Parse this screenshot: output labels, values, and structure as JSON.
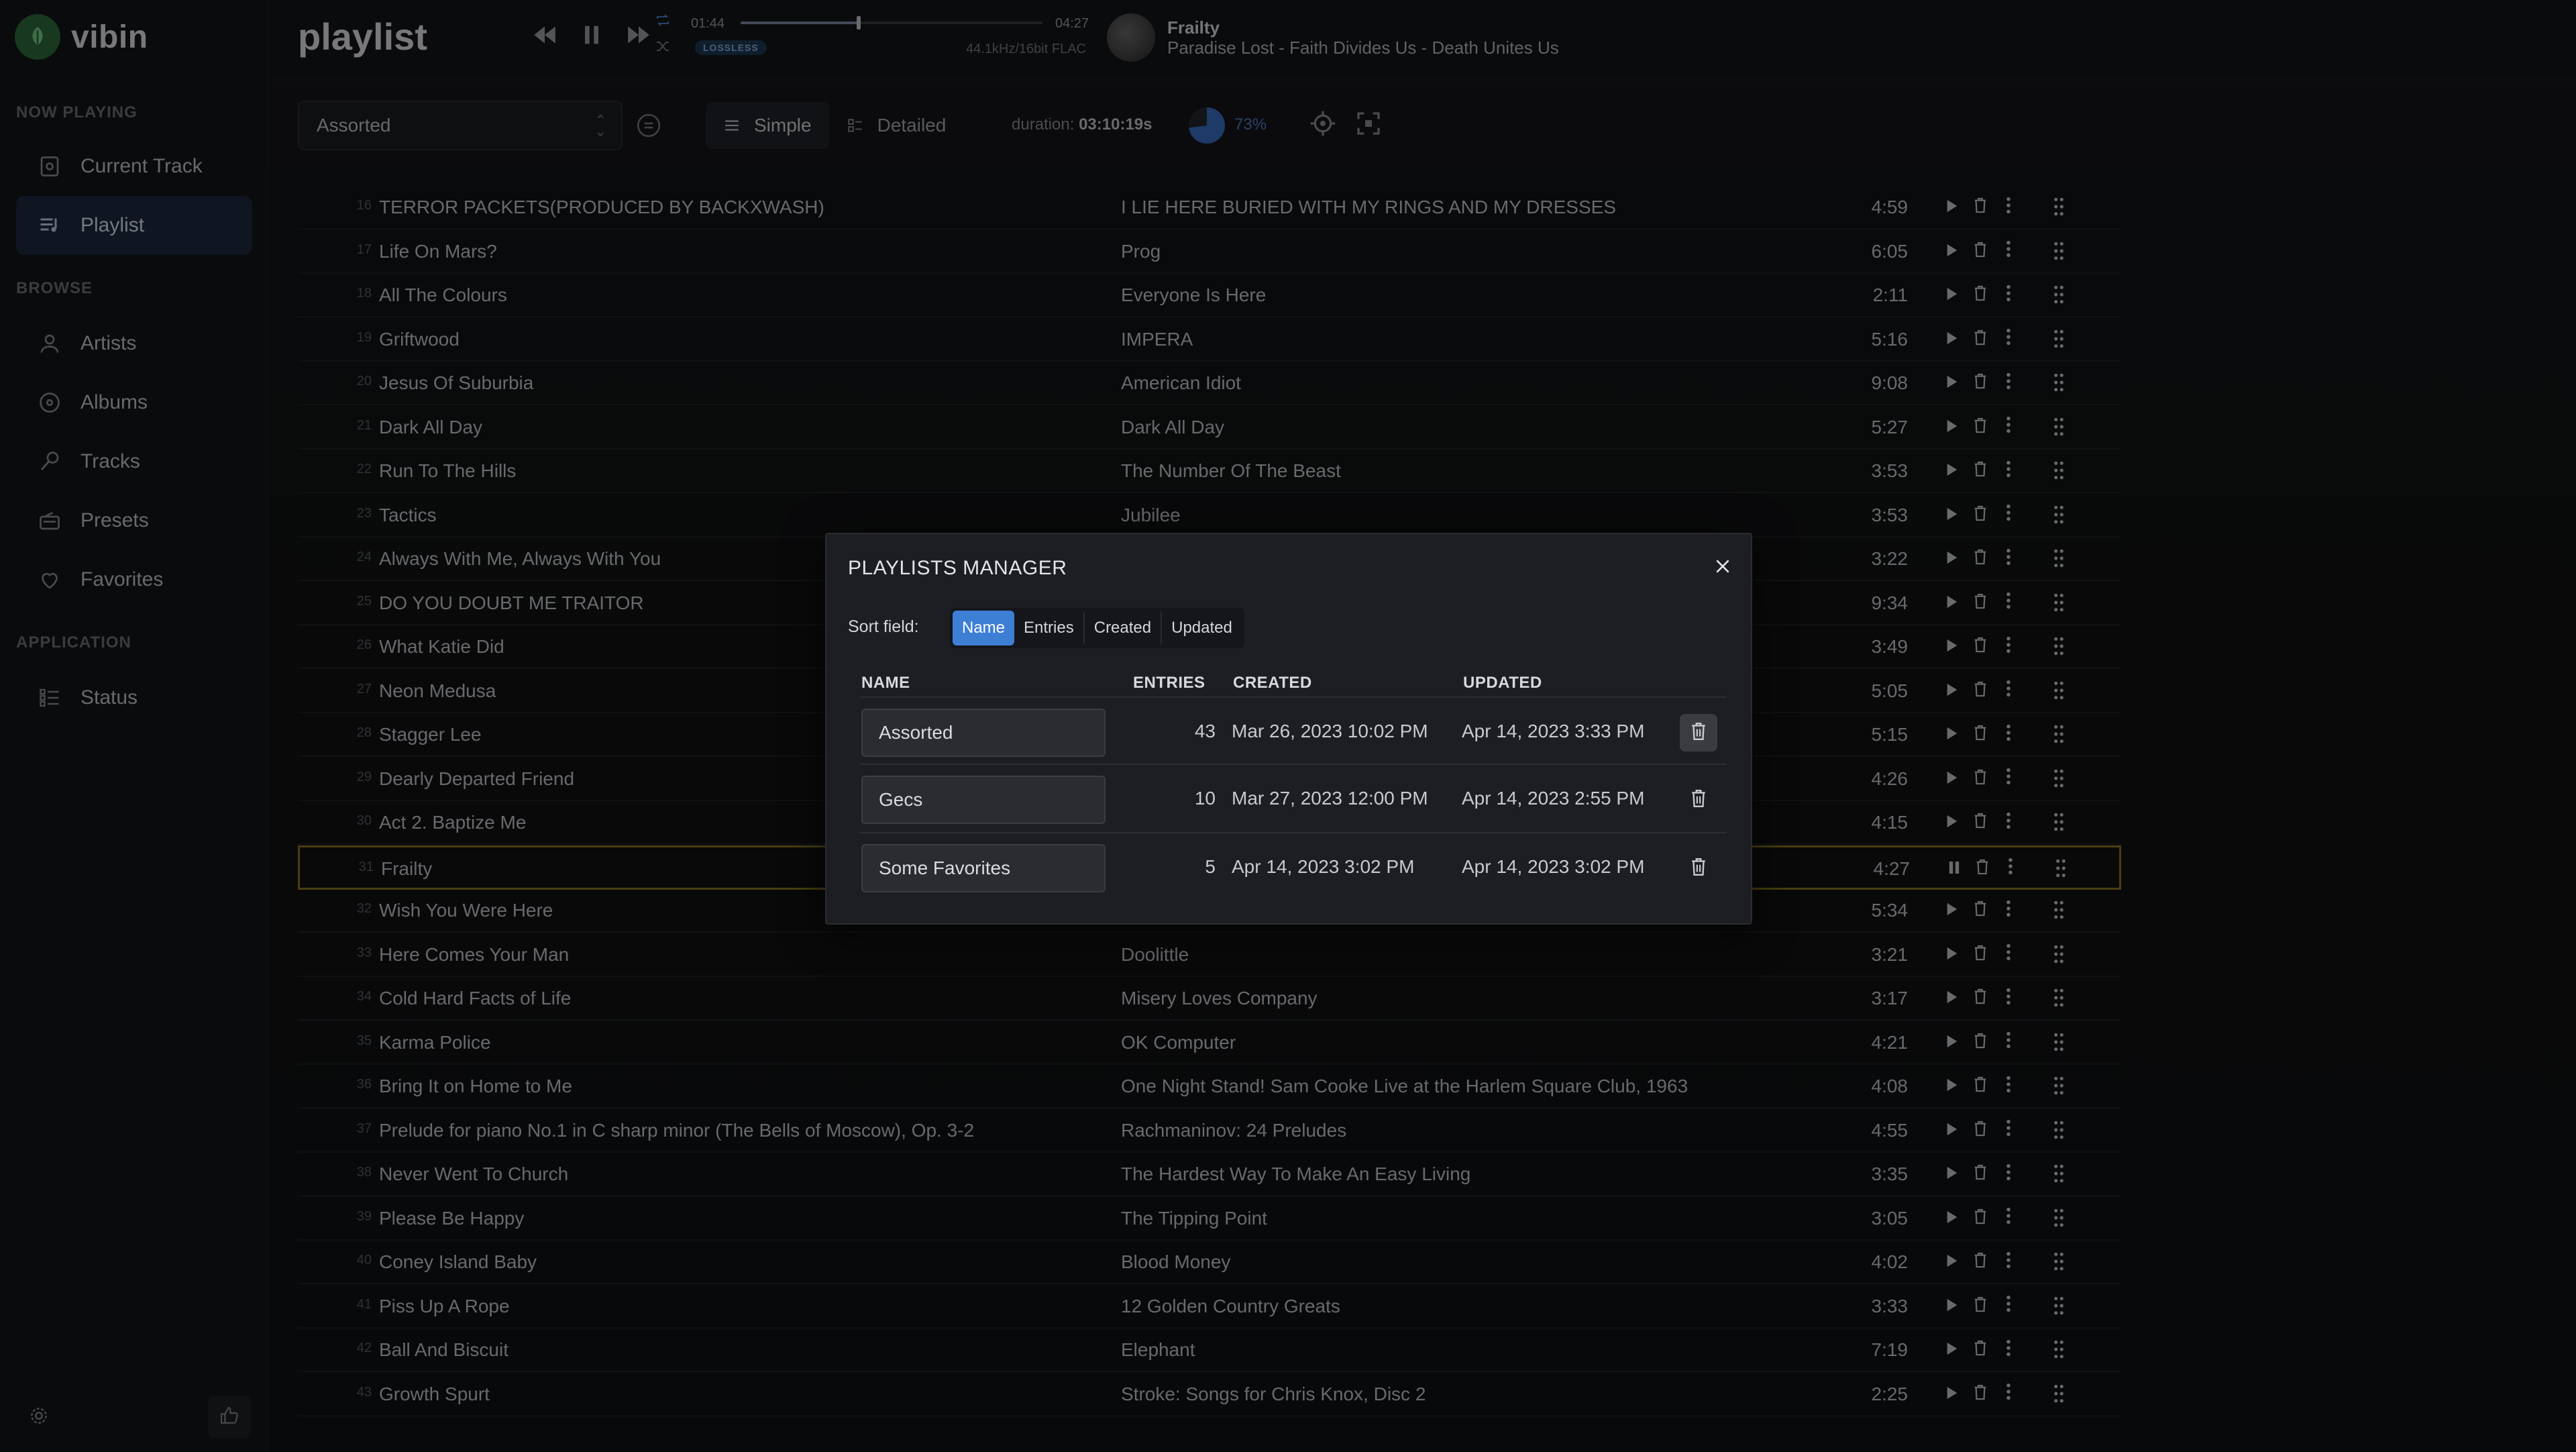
{
  "app": {
    "name": "vibin",
    "page_title": "playlist"
  },
  "sidebar": {
    "sections": [
      {
        "label": "NOW PLAYING"
      },
      {
        "label": "BROWSE"
      },
      {
        "label": "APPLICATION"
      }
    ],
    "items": [
      {
        "label": "Current Track",
        "icon": "current-track-icon"
      },
      {
        "label": "Playlist",
        "icon": "playlist-icon",
        "active": true
      },
      {
        "label": "Artists",
        "icon": "artists-icon"
      },
      {
        "label": "Albums",
        "icon": "albums-icon"
      },
      {
        "label": "Tracks",
        "icon": "tracks-icon"
      },
      {
        "label": "Presets",
        "icon": "presets-icon"
      },
      {
        "label": "Favorites",
        "icon": "favorites-icon"
      },
      {
        "label": "Status",
        "icon": "status-icon"
      }
    ]
  },
  "player": {
    "current_time": "01:44",
    "total_time": "04:27",
    "progress_fraction": 0.39,
    "badge": "LOSSLESS",
    "format": "44.1kHz/16bit FLAC",
    "now_playing_title": "Frailty",
    "now_playing_subtitle": "Paradise Lost - Faith Divides Us - Death Unites Us"
  },
  "toolbar": {
    "playlist_select": "Assorted",
    "view_simple": "Simple",
    "view_detailed": "Detailed",
    "duration_label": "duration:",
    "duration_value": "03:10:19s",
    "progress_pct": "73%",
    "progress_value": 0.73
  },
  "tracks": [
    {
      "num": "16",
      "title": "TERROR PACKETS(PRODUCED BY BACKXWASH)",
      "album": "I LIE HERE BURIED WITH MY RINGS AND MY DRESSES",
      "dur": "4:59"
    },
    {
      "num": "17",
      "title": "Life On Mars?",
      "album": "Prog",
      "dur": "6:05"
    },
    {
      "num": "18",
      "title": "All The Colours",
      "album": "Everyone Is Here",
      "dur": "2:11"
    },
    {
      "num": "19",
      "title": "Griftwood",
      "album": "IMPERA",
      "dur": "5:16"
    },
    {
      "num": "20",
      "title": "Jesus Of Suburbia",
      "album": "American Idiot",
      "dur": "9:08"
    },
    {
      "num": "21",
      "title": "Dark All Day",
      "album": "Dark All Day",
      "dur": "5:27"
    },
    {
      "num": "22",
      "title": "Run To The Hills",
      "album": "The Number Of The Beast",
      "dur": "3:53"
    },
    {
      "num": "23",
      "title": "Tactics",
      "album": "Jubilee",
      "dur": "3:53"
    },
    {
      "num": "24",
      "title": "Always With Me, Always With You",
      "album": "",
      "dur": "3:22"
    },
    {
      "num": "25",
      "title": "DO YOU DOUBT ME TRAITOR",
      "album": "",
      "dur": "9:34"
    },
    {
      "num": "26",
      "title": "What Katie Did",
      "album": "",
      "dur": "3:49"
    },
    {
      "num": "27",
      "title": "Neon Medusa",
      "album": "",
      "dur": "5:05"
    },
    {
      "num": "28",
      "title": "Stagger Lee",
      "album": "",
      "dur": "5:15"
    },
    {
      "num": "29",
      "title": "Dearly Departed Friend",
      "album": "",
      "dur": "4:26"
    },
    {
      "num": "30",
      "title": "Act 2. Baptize Me",
      "album": "",
      "dur": "4:15"
    },
    {
      "num": "31",
      "title": "Frailty",
      "album": "",
      "dur": "4:27",
      "current": true
    },
    {
      "num": "32",
      "title": "Wish You Were Here",
      "album": "",
      "dur": "5:34"
    },
    {
      "num": "33",
      "title": "Here Comes Your Man",
      "album": "Doolittle",
      "dur": "3:21"
    },
    {
      "num": "34",
      "title": "Cold Hard Facts of Life",
      "album": "Misery Loves Company",
      "dur": "3:17"
    },
    {
      "num": "35",
      "title": "Karma Police",
      "album": "OK Computer",
      "dur": "4:21"
    },
    {
      "num": "36",
      "title": "Bring It on Home to Me",
      "album": "One Night Stand! Sam Cooke Live at the Harlem Square Club, 1963",
      "dur": "4:08"
    },
    {
      "num": "37",
      "title": "Prelude for piano No.1 in C sharp minor (The Bells of Moscow), Op. 3-2",
      "album": "Rachmaninov: 24 Preludes",
      "dur": "4:55"
    },
    {
      "num": "38",
      "title": "Never Went To Church",
      "album": "The Hardest Way To Make An Easy Living",
      "dur": "3:35"
    },
    {
      "num": "39",
      "title": "Please Be Happy",
      "album": "The Tipping Point",
      "dur": "3:05"
    },
    {
      "num": "40",
      "title": "Coney Island Baby",
      "album": "Blood Money",
      "dur": "4:02"
    },
    {
      "num": "41",
      "title": "Piss Up A Rope",
      "album": "12 Golden Country Greats",
      "dur": "3:33"
    },
    {
      "num": "42",
      "title": "Ball And Biscuit",
      "album": "Elephant",
      "dur": "7:19"
    },
    {
      "num": "43",
      "title": "Growth Spurt",
      "album": "Stroke: Songs for Chris Knox, Disc 2",
      "dur": "2:25"
    }
  ],
  "modal": {
    "title": "PLAYLISTS MANAGER",
    "sort_label": "Sort field:",
    "sort_options": [
      "Name",
      "Entries",
      "Created",
      "Updated"
    ],
    "sort_active": "Name",
    "headers": {
      "name": "NAME",
      "entries": "ENTRIES",
      "created": "CREATED",
      "updated": "UPDATED"
    },
    "playlists": [
      {
        "name": "Assorted",
        "entries": "43",
        "created": "Mar 26, 2023 10:02 PM",
        "updated": "Apr 14, 2023 3:33 PM"
      },
      {
        "name": "Gecs",
        "entries": "10",
        "created": "Mar 27, 2023 12:00 PM",
        "updated": "Apr 14, 2023 2:55 PM"
      },
      {
        "name": "Some Favorites",
        "entries": "5",
        "created": "Apr 14, 2023 3:02 PM",
        "updated": "Apr 14, 2023 3:02 PM"
      }
    ]
  },
  "colors": {
    "accent": "#3e7fd6",
    "current_row_border": "#8a7a1f",
    "logo_green": "#2f6b3c"
  }
}
